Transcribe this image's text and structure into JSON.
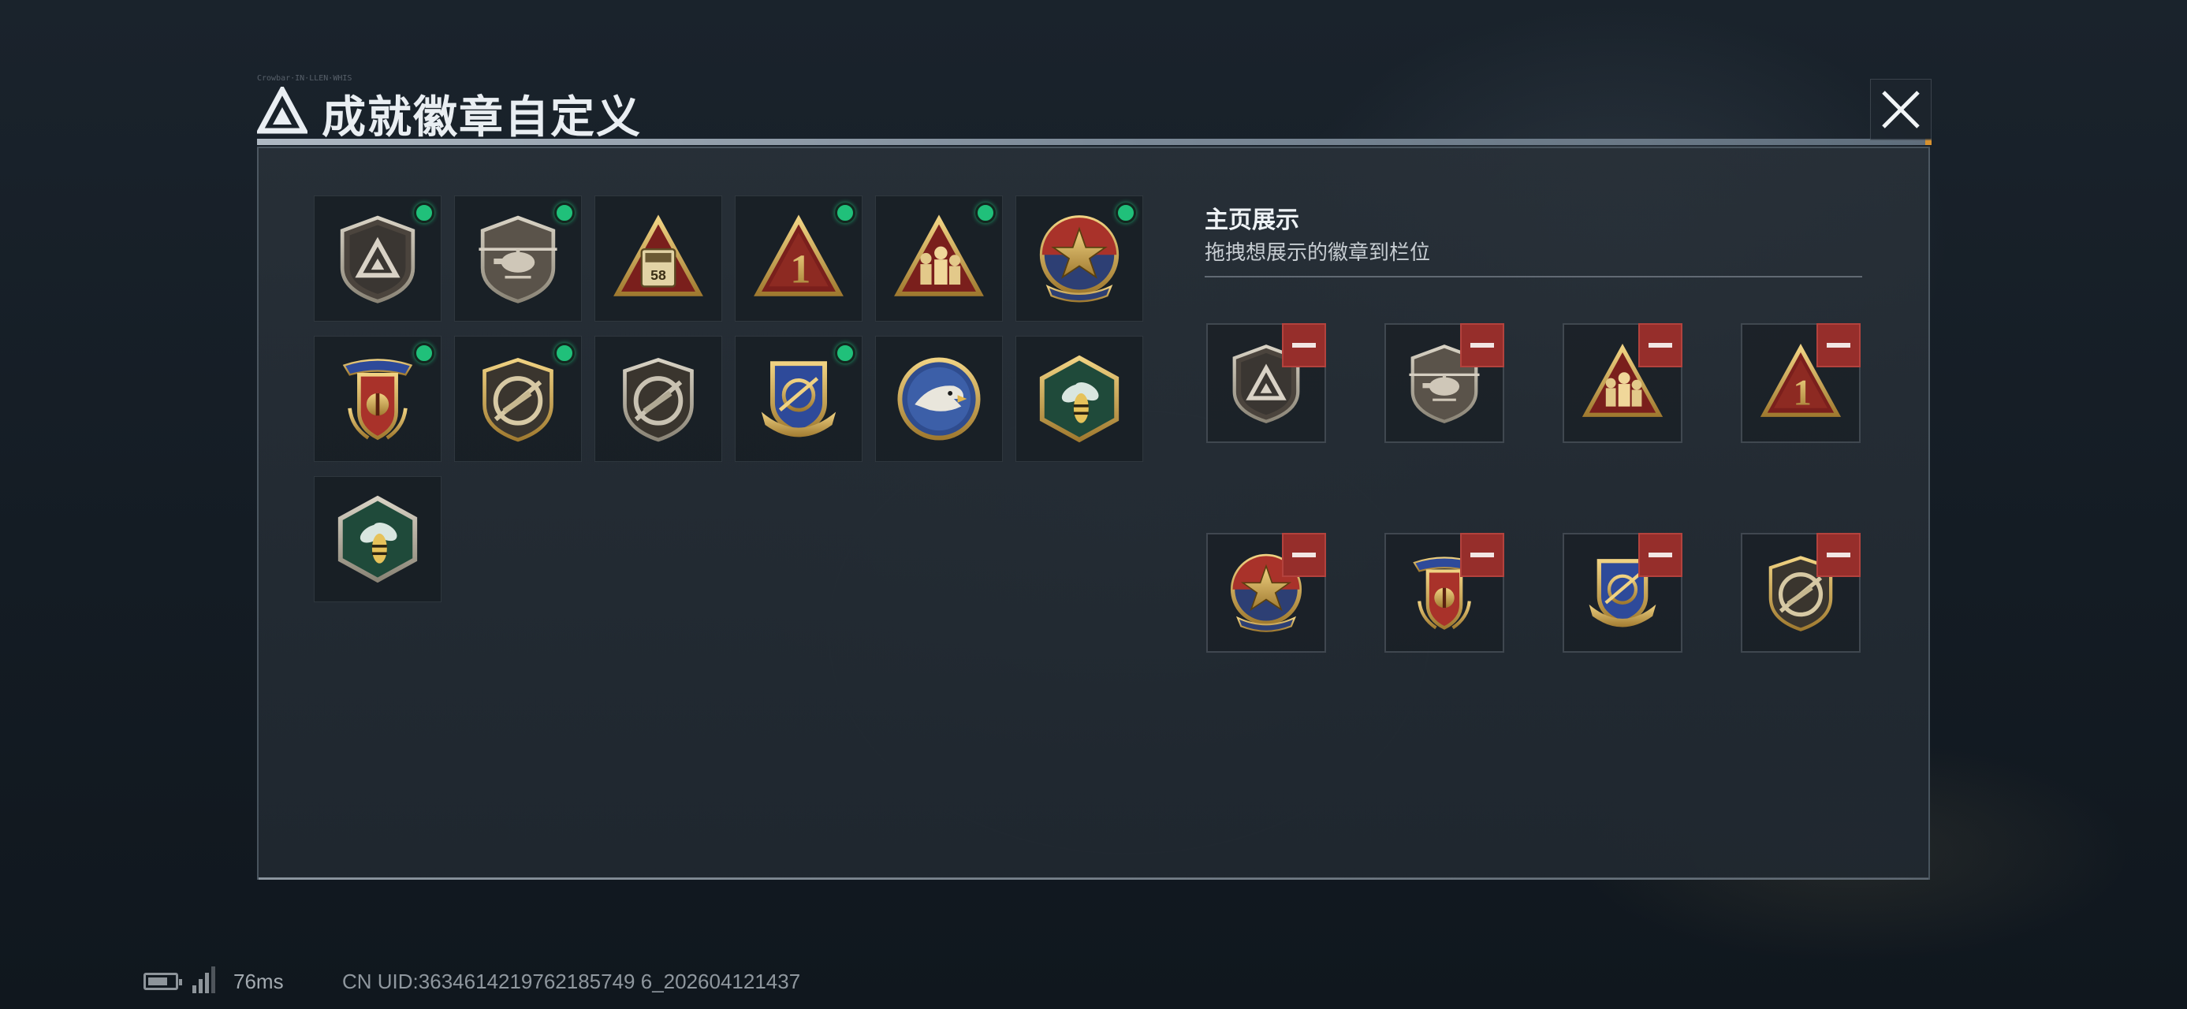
{
  "window": {
    "title": "成就徽章自定义",
    "header_small_text": "Crowbar·IN·LLEN·WHIS"
  },
  "badges": [
    {
      "name": "triangle-shield-badge",
      "is_new": true
    },
    {
      "name": "helicopter-badge",
      "is_new": true
    },
    {
      "name": "bus-58-badge",
      "is_new": false,
      "label": "58"
    },
    {
      "name": "number-one-badge",
      "is_new": true,
      "label": "1"
    },
    {
      "name": "soldiers-triangle-badge",
      "is_new": true
    },
    {
      "name": "star-emblem-badge",
      "is_new": true
    },
    {
      "name": "ribbon-shield-badge",
      "is_new": true
    },
    {
      "name": "rifle-badge-gold",
      "is_new": true
    },
    {
      "name": "rifle-badge-silver",
      "is_new": false
    },
    {
      "name": "crossed-rifle-crest-badge",
      "is_new": true
    },
    {
      "name": "eagle-badge",
      "is_new": false
    },
    {
      "name": "hornet-badge-gold",
      "is_new": false
    },
    {
      "name": "hornet-badge-silver",
      "is_new": false
    }
  ],
  "showcase": {
    "title": "主页展示",
    "subtitle": "拖拽想展示的徽章到栏位",
    "slots": [
      {
        "badge": "triangle-shield-badge"
      },
      {
        "badge": "helicopter-badge"
      },
      {
        "badge": "soldiers-triangle-badge"
      },
      {
        "badge": "number-one-badge",
        "label": "1"
      },
      {
        "badge": "star-emblem-badge"
      },
      {
        "badge": "ribbon-shield-badge"
      },
      {
        "badge": "crossed-rifle-crest-badge"
      },
      {
        "badge": "rifle-badge-gold"
      }
    ]
  },
  "status_bar": {
    "ping": "76ms",
    "uid": "CN UID:3634614219762185749 6_202604121437"
  },
  "colors": {
    "accent_orange": "#d6912f",
    "new_dot": "#20c07a",
    "remove_red": "#962e2b"
  }
}
